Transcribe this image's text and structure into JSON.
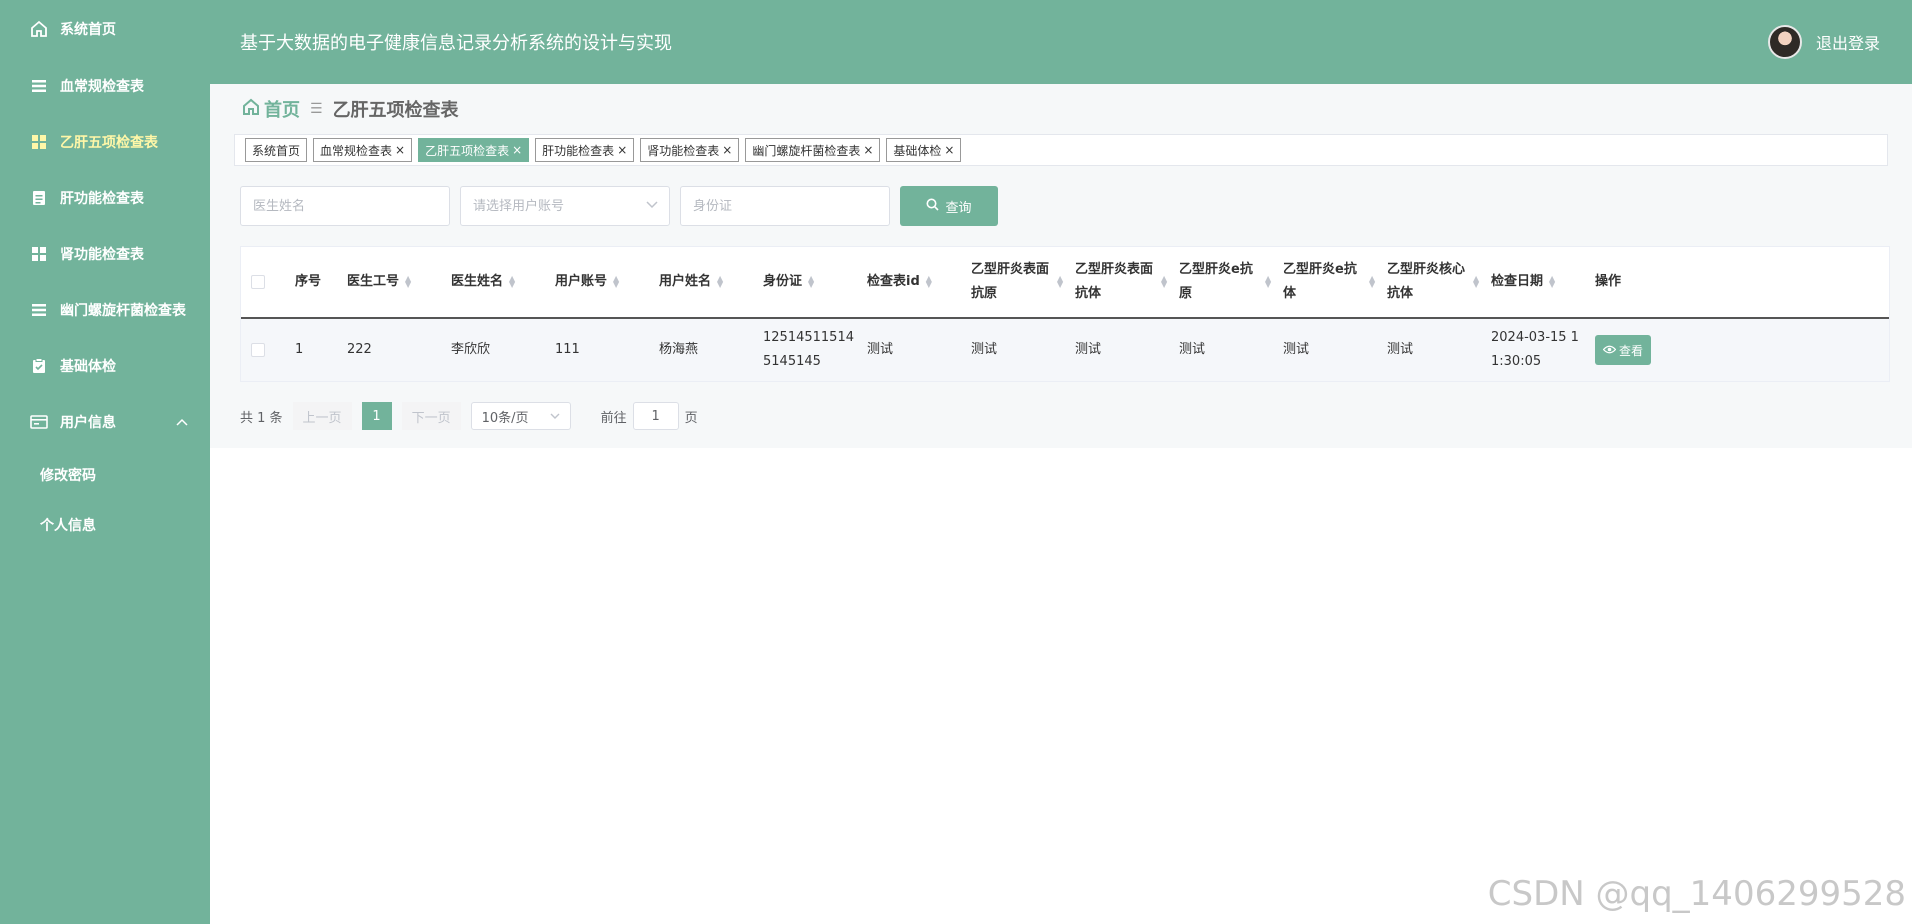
{
  "sidebar": {
    "items": [
      {
        "label": "系统首页",
        "icon": "home-icon"
      },
      {
        "label": "血常规检查表",
        "icon": "list-icon"
      },
      {
        "label": "乙肝五项检查表",
        "icon": "grid-icon",
        "active": true
      },
      {
        "label": "肝功能检查表",
        "icon": "document-icon"
      },
      {
        "label": "肾功能检查表",
        "icon": "grid-icon"
      },
      {
        "label": "幽门螺旋杆菌检查表",
        "icon": "list-icon"
      },
      {
        "label": "基础体检",
        "icon": "clipboard-icon"
      },
      {
        "label": "用户信息",
        "icon": "card-icon",
        "expanded": true
      }
    ],
    "sub_items": [
      {
        "label": "修改密码"
      },
      {
        "label": "个人信息"
      }
    ]
  },
  "header": {
    "title": "基于大数据的电子健康信息记录分析系统的设计与实现",
    "logout": "退出登录"
  },
  "breadcrumb": {
    "home": "首页",
    "current": "乙肝五项检查表"
  },
  "tags": [
    {
      "label": "系统首页",
      "closable": false
    },
    {
      "label": "血常规检查表",
      "closable": true
    },
    {
      "label": "乙肝五项检查表",
      "closable": true,
      "active": true
    },
    {
      "label": "肝功能检查表",
      "closable": true
    },
    {
      "label": "肾功能检查表",
      "closable": true
    },
    {
      "label": "幽门螺旋杆菌检查表",
      "closable": true
    },
    {
      "label": "基础体检",
      "closable": true
    }
  ],
  "filters": {
    "doctor_name_placeholder": "医生姓名",
    "user_account_placeholder": "请选择用户账号",
    "id_card_placeholder": "身份证",
    "query_label": "查询"
  },
  "table": {
    "columns": [
      "序号",
      "医生工号",
      "医生姓名",
      "用户账号",
      "用户姓名",
      "身份证",
      "检查表id",
      "乙型肝炎表面抗原",
      "乙型肝炎表面抗体",
      "乙型肝炎e抗原",
      "乙型肝炎e抗体",
      "乙型肝炎核心抗体",
      "检查日期",
      "操作"
    ],
    "rows": [
      [
        "1",
        "222",
        "李欣欣",
        "111",
        "杨海燕",
        "125145115145145145",
        "测试",
        "测试",
        "测试",
        "测试",
        "测试",
        "测试",
        "2024-03-15 11:30:05"
      ]
    ],
    "view_label": "查看"
  },
  "pagination": {
    "total": "共 1 条",
    "prev": "上一页",
    "page": "1",
    "next": "下一页",
    "page_size": "10条/页",
    "goto_label": "前往",
    "goto_value": "1",
    "page_unit": "页"
  },
  "watermark": "CSDN @qq_1406299528",
  "colors": {
    "primary": "#72b39b",
    "active_menu": "#fff7a8"
  }
}
